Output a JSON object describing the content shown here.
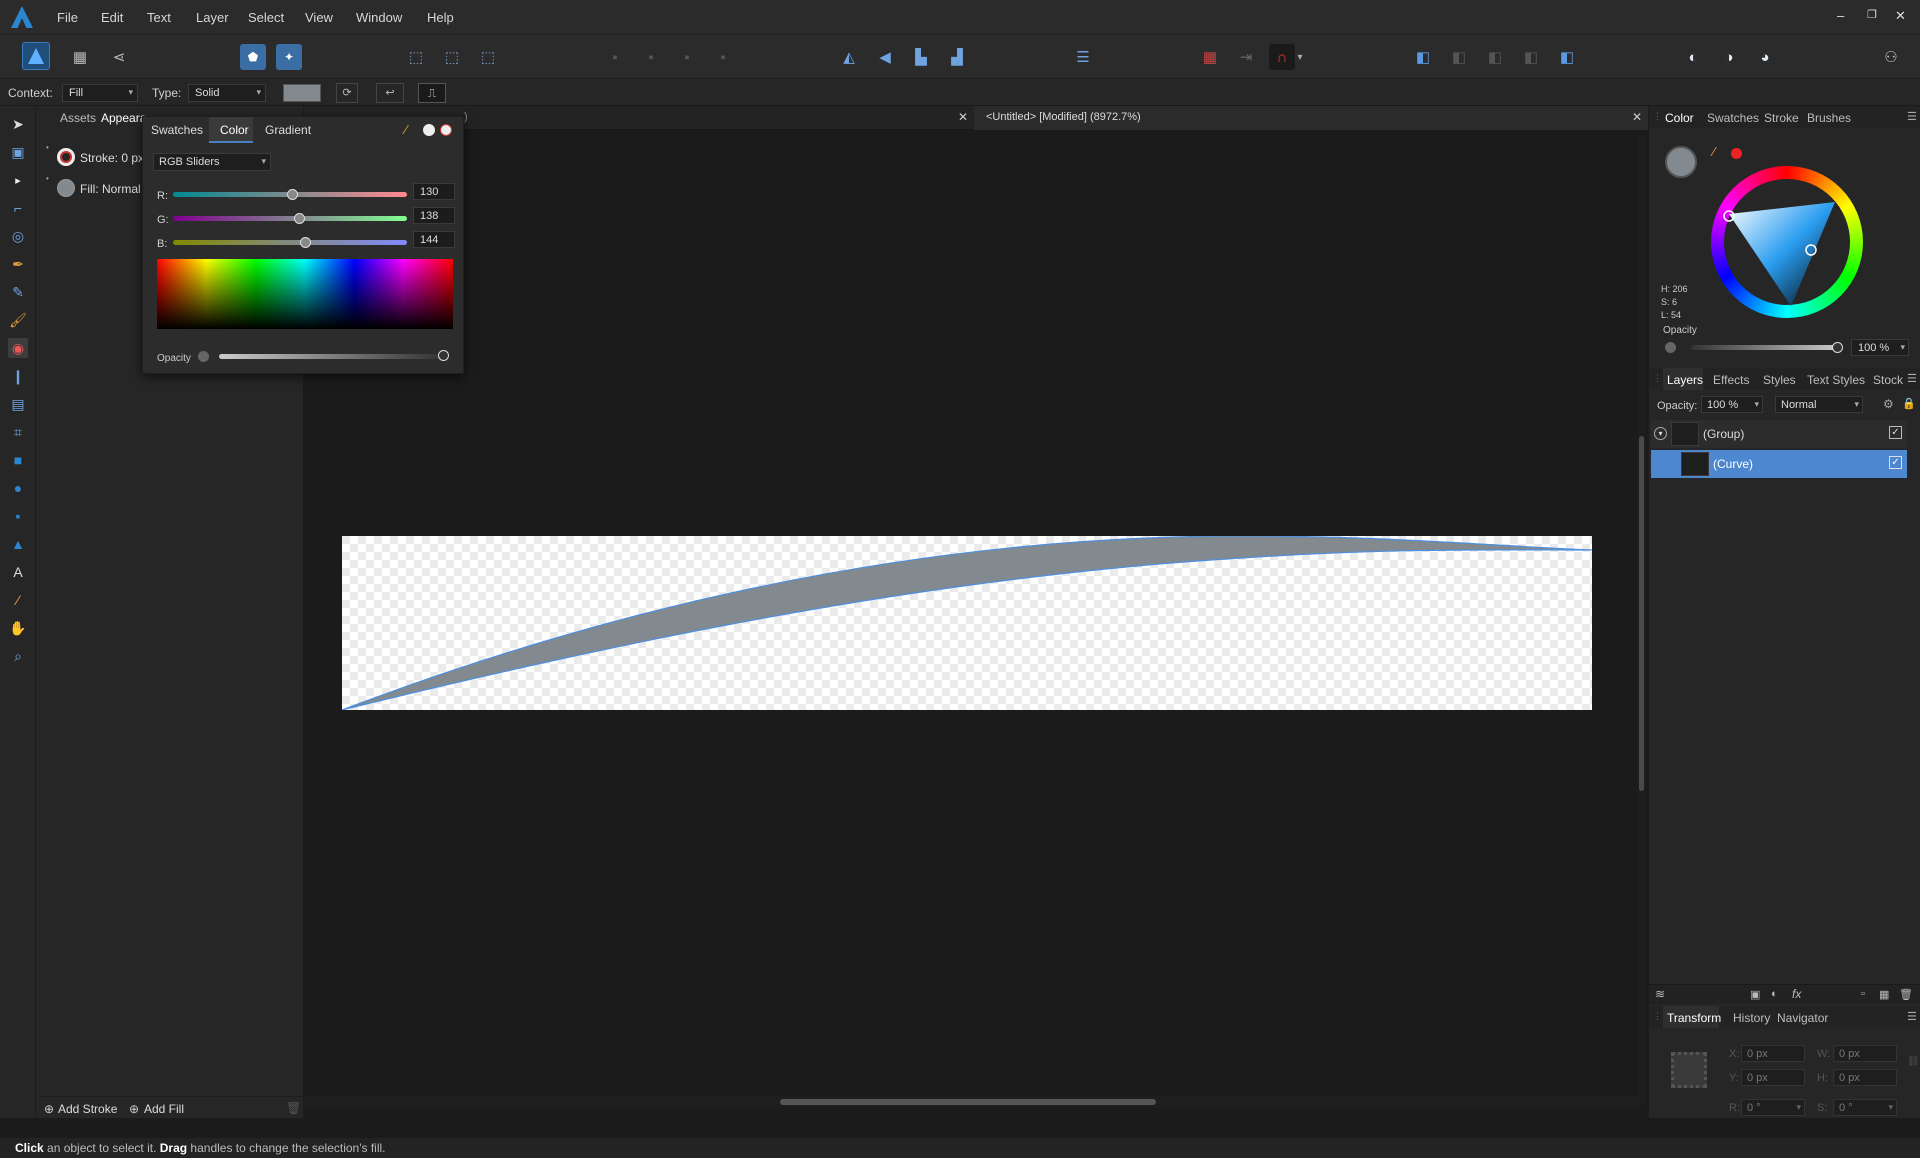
{
  "menu": [
    "File",
    "Edit",
    "Text",
    "Layer",
    "Select",
    "View",
    "Window",
    "Help"
  ],
  "context": {
    "context_label": "Context:",
    "context_value": "Fill",
    "type_label": "Type:",
    "type_value": "Solid"
  },
  "left_panel": {
    "tabs": [
      "Assets",
      "Appeara"
    ],
    "stroke_label": "Stroke: 0 px",
    "fill_label": "Fill: Normal",
    "add_stroke": "Add Stroke",
    "add_fill": "Add Fill"
  },
  "color_popup": {
    "tabs": [
      "Swatches",
      "Color",
      "Gradient"
    ],
    "mode": "RGB Sliders",
    "r_label": "R:",
    "g_label": "G:",
    "b_label": "B:",
    "r": "130",
    "g": "138",
    "b": "144",
    "r_frac": 0.51,
    "g_frac": 0.54,
    "b_frac": 0.565,
    "opacity_label": "Opacity"
  },
  "doc": {
    "tab_left_suffix": ")",
    "tab_title": "<Untitled> [Modified] (8972.7%)"
  },
  "right_color": {
    "tabs": [
      "Color",
      "Swatches",
      "Stroke",
      "Brushes"
    ],
    "h": "H: 206",
    "s": "S: 6",
    "l": "L: 54",
    "opacity_label": "Opacity",
    "opacity_value": "100 %"
  },
  "layers": {
    "tabs": [
      "Layers",
      "Effects",
      "Styles",
      "Text Styles",
      "Stock"
    ],
    "opacity_label": "Opacity:",
    "opacity_value": "100 %",
    "blend": "Normal",
    "items": [
      "(Group)",
      "(Curve)"
    ]
  },
  "transform": {
    "tabs": [
      "Transform",
      "History",
      "Navigator"
    ],
    "x": "0 px",
    "y": "0 px",
    "w": "0 px",
    "h": "0 px",
    "r": "0 °",
    "s": "0 °",
    "x_label": "X:",
    "y_label": "Y:",
    "w_label": "W:",
    "h_label": "H:",
    "r_label": "R:",
    "s_label": "S:"
  },
  "status": {
    "click": "Click",
    "text1": " an object to select it. ",
    "drag": "Drag",
    "text2": " handles to change the selection's fill."
  },
  "colors": {
    "fill": "#828a90",
    "accent": "#5b8fd6"
  }
}
